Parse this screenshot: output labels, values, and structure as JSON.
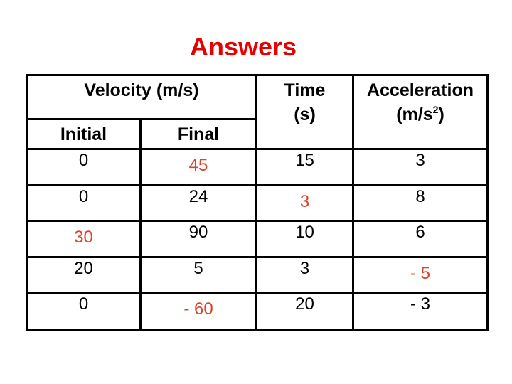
{
  "title": "Answers",
  "colors": {
    "title": "#e60000",
    "answer": "#d9442a"
  },
  "table": {
    "headers": {
      "velocity": "Velocity (m/s)",
      "initial": "Initial",
      "final": "Final",
      "time": "Time",
      "time_unit": "(s)",
      "acceleration": "Acceleration",
      "acceleration_unit_prefix": "(m/s",
      "acceleration_unit_exp": "2",
      "acceleration_unit_suffix": ")"
    },
    "rows": [
      {
        "initial": "0",
        "final": "45",
        "time": "15",
        "acceleration": "3",
        "answer": "final"
      },
      {
        "initial": "0",
        "final": "24",
        "time": "3",
        "acceleration": "8",
        "answer": "time"
      },
      {
        "initial": "30",
        "final": "90",
        "time": "10",
        "acceleration": "6",
        "answer": "initial"
      },
      {
        "initial": "20",
        "final": "5",
        "time": "3",
        "acceleration": "- 5",
        "answer": "acceleration"
      },
      {
        "initial": "0",
        "final": "- 60",
        "time": "20",
        "acceleration": "- 3",
        "answer": "final"
      }
    ]
  }
}
